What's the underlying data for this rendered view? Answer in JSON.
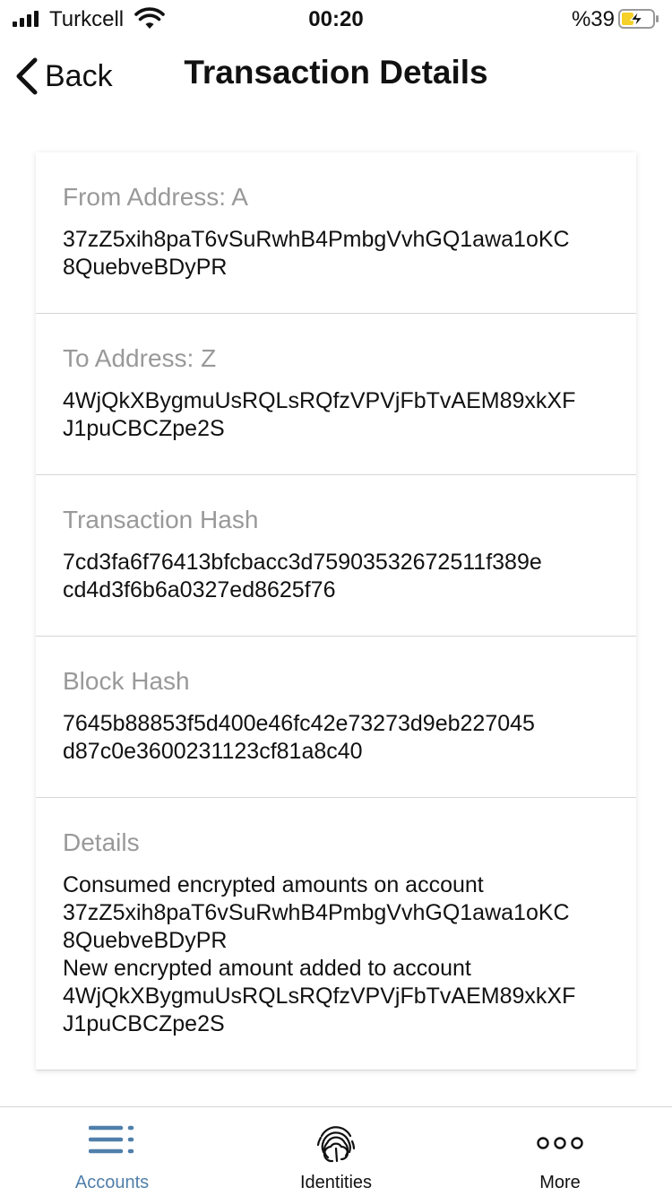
{
  "status_bar": {
    "carrier": "Turkcell",
    "time": "00:20",
    "battery_percent": "%39",
    "battery_level": 0.39
  },
  "nav": {
    "back_label": "Back",
    "title": "Transaction Details"
  },
  "sections": {
    "from": {
      "label": "From Address: A",
      "value_line1": "37zZ5xih8paT6vSuRwhB4PmbgVvhGQ1awa1oKC",
      "value_line2": "8QuebveBDyPR"
    },
    "to": {
      "label": "To Address: Z",
      "value_line1": "4WjQkXBygmuUsRQLsRQfzVPVjFbTvAEM89xkXF",
      "value_line2": "J1puCBCZpe2S"
    },
    "tx_hash": {
      "label": "Transaction Hash",
      "value_line1": "7cd3fa6f76413bfcbacc3d75903532672511f389e",
      "value_line2": "cd4d3f6b6a0327ed8625f76"
    },
    "block_hash": {
      "label": "Block Hash",
      "value_line1": "7645b88853f5d400e46fc42e73273d9eb227045",
      "value_line2": "d87c0e3600231123cf81a8c40"
    },
    "details": {
      "label": "Details",
      "lines": [
        "Consumed encrypted amounts on account",
        "37zZ5xih8paT6vSuRwhB4PmbgVvhGQ1awa1oKC",
        "8QuebveBDyPR",
        "New encrypted amount added to account",
        "4WjQkXBygmuUsRQLsRQfzVPVjFbTvAEM89xkXF",
        "J1puCBCZpe2S"
      ]
    }
  },
  "tab_bar": {
    "tabs": [
      {
        "label": "Accounts",
        "icon": "accounts-list-icon",
        "active": true
      },
      {
        "label": "Identities",
        "icon": "fingerprint-icon",
        "active": false
      },
      {
        "label": "More",
        "icon": "more-dots-icon",
        "active": false
      }
    ]
  },
  "colors": {
    "accent": "#4f7faa",
    "label_gray": "#999999",
    "text": "#111111",
    "divider": "#d6d6d6",
    "battery_charging": "#f5d028"
  }
}
